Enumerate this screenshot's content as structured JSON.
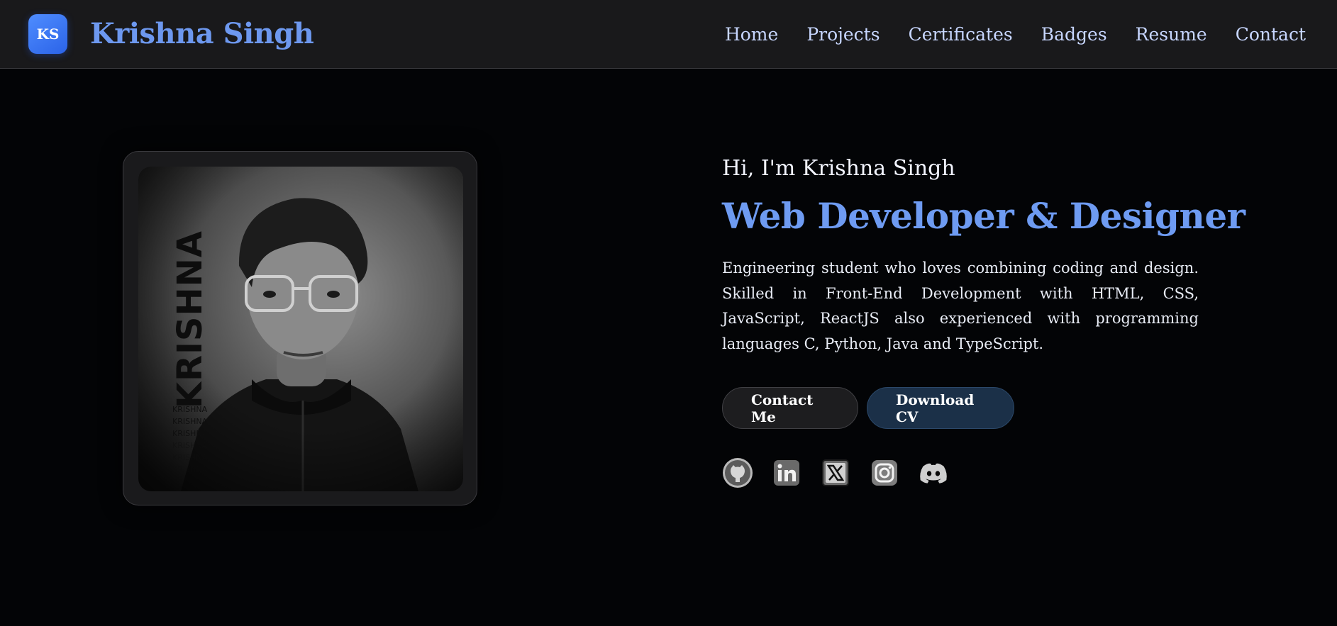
{
  "header": {
    "logo_initials": "KS",
    "brand_name": "Krishna Singh",
    "nav": [
      {
        "label": "Home"
      },
      {
        "label": "Projects"
      },
      {
        "label": "Certificates"
      },
      {
        "label": "Badges"
      },
      {
        "label": "Resume"
      },
      {
        "label": "Contact"
      }
    ]
  },
  "photo": {
    "vertical_text": "KRISHNA",
    "small_names": [
      "KRISHNA",
      "KRISHNA",
      "KRISHNA",
      "KRISHNA",
      "KRISHNA",
      "KRISHNA"
    ]
  },
  "hero": {
    "greeting": "Hi, I'm Krishna Singh",
    "headline": "Web Developer & Designer",
    "bio": "Engineering student who loves combining coding and design. Skilled in Front-End Development with HTML, CSS, JavaScript, ReactJS also experienced with programming languages C, Python, Java and TypeScript.",
    "contact_button": "Contact Me",
    "cv_button": "Download CV"
  },
  "socials": [
    {
      "icon": "github-icon"
    },
    {
      "icon": "linkedin-icon"
    },
    {
      "icon": "x-twitter-icon"
    },
    {
      "icon": "instagram-icon"
    },
    {
      "icon": "discord-icon"
    }
  ],
  "colors": {
    "accent": "#6e9bf2",
    "logo_badge": "#3a78f5",
    "background": "#030406",
    "header_bg": "#19191b",
    "nav_text": "#c7d6ff",
    "cv_button_bg": "#1b3048"
  }
}
